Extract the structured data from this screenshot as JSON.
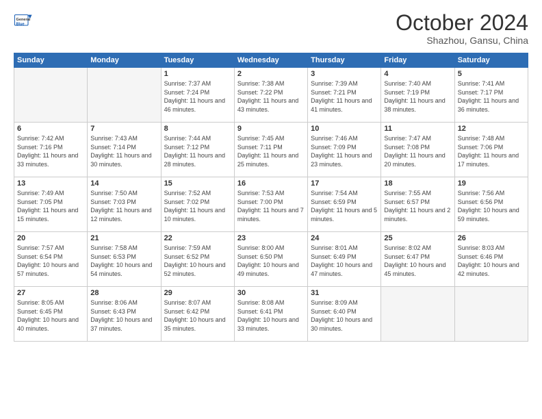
{
  "header": {
    "logo_general": "General",
    "logo_blue": "Blue",
    "month_title": "October 2024",
    "location": "Shazhou, Gansu, China"
  },
  "days_of_week": [
    "Sunday",
    "Monday",
    "Tuesday",
    "Wednesday",
    "Thursday",
    "Friday",
    "Saturday"
  ],
  "weeks": [
    [
      {
        "day": "",
        "info": ""
      },
      {
        "day": "",
        "info": ""
      },
      {
        "day": "1",
        "info": "Sunrise: 7:37 AM\nSunset: 7:24 PM\nDaylight: 11 hours\nand 46 minutes."
      },
      {
        "day": "2",
        "info": "Sunrise: 7:38 AM\nSunset: 7:22 PM\nDaylight: 11 hours\nand 43 minutes."
      },
      {
        "day": "3",
        "info": "Sunrise: 7:39 AM\nSunset: 7:21 PM\nDaylight: 11 hours\nand 41 minutes."
      },
      {
        "day": "4",
        "info": "Sunrise: 7:40 AM\nSunset: 7:19 PM\nDaylight: 11 hours\nand 38 minutes."
      },
      {
        "day": "5",
        "info": "Sunrise: 7:41 AM\nSunset: 7:17 PM\nDaylight: 11 hours\nand 36 minutes."
      }
    ],
    [
      {
        "day": "6",
        "info": "Sunrise: 7:42 AM\nSunset: 7:16 PM\nDaylight: 11 hours\nand 33 minutes."
      },
      {
        "day": "7",
        "info": "Sunrise: 7:43 AM\nSunset: 7:14 PM\nDaylight: 11 hours\nand 30 minutes."
      },
      {
        "day": "8",
        "info": "Sunrise: 7:44 AM\nSunset: 7:12 PM\nDaylight: 11 hours\nand 28 minutes."
      },
      {
        "day": "9",
        "info": "Sunrise: 7:45 AM\nSunset: 7:11 PM\nDaylight: 11 hours\nand 25 minutes."
      },
      {
        "day": "10",
        "info": "Sunrise: 7:46 AM\nSunset: 7:09 PM\nDaylight: 11 hours\nand 23 minutes."
      },
      {
        "day": "11",
        "info": "Sunrise: 7:47 AM\nSunset: 7:08 PM\nDaylight: 11 hours\nand 20 minutes."
      },
      {
        "day": "12",
        "info": "Sunrise: 7:48 AM\nSunset: 7:06 PM\nDaylight: 11 hours\nand 17 minutes."
      }
    ],
    [
      {
        "day": "13",
        "info": "Sunrise: 7:49 AM\nSunset: 7:05 PM\nDaylight: 11 hours\nand 15 minutes."
      },
      {
        "day": "14",
        "info": "Sunrise: 7:50 AM\nSunset: 7:03 PM\nDaylight: 11 hours\nand 12 minutes."
      },
      {
        "day": "15",
        "info": "Sunrise: 7:52 AM\nSunset: 7:02 PM\nDaylight: 11 hours\nand 10 minutes."
      },
      {
        "day": "16",
        "info": "Sunrise: 7:53 AM\nSunset: 7:00 PM\nDaylight: 11 hours\nand 7 minutes."
      },
      {
        "day": "17",
        "info": "Sunrise: 7:54 AM\nSunset: 6:59 PM\nDaylight: 11 hours\nand 5 minutes."
      },
      {
        "day": "18",
        "info": "Sunrise: 7:55 AM\nSunset: 6:57 PM\nDaylight: 11 hours\nand 2 minutes."
      },
      {
        "day": "19",
        "info": "Sunrise: 7:56 AM\nSunset: 6:56 PM\nDaylight: 10 hours\nand 59 minutes."
      }
    ],
    [
      {
        "day": "20",
        "info": "Sunrise: 7:57 AM\nSunset: 6:54 PM\nDaylight: 10 hours\nand 57 minutes."
      },
      {
        "day": "21",
        "info": "Sunrise: 7:58 AM\nSunset: 6:53 PM\nDaylight: 10 hours\nand 54 minutes."
      },
      {
        "day": "22",
        "info": "Sunrise: 7:59 AM\nSunset: 6:52 PM\nDaylight: 10 hours\nand 52 minutes."
      },
      {
        "day": "23",
        "info": "Sunrise: 8:00 AM\nSunset: 6:50 PM\nDaylight: 10 hours\nand 49 minutes."
      },
      {
        "day": "24",
        "info": "Sunrise: 8:01 AM\nSunset: 6:49 PM\nDaylight: 10 hours\nand 47 minutes."
      },
      {
        "day": "25",
        "info": "Sunrise: 8:02 AM\nSunset: 6:47 PM\nDaylight: 10 hours\nand 45 minutes."
      },
      {
        "day": "26",
        "info": "Sunrise: 8:03 AM\nSunset: 6:46 PM\nDaylight: 10 hours\nand 42 minutes."
      }
    ],
    [
      {
        "day": "27",
        "info": "Sunrise: 8:05 AM\nSunset: 6:45 PM\nDaylight: 10 hours\nand 40 minutes."
      },
      {
        "day": "28",
        "info": "Sunrise: 8:06 AM\nSunset: 6:43 PM\nDaylight: 10 hours\nand 37 minutes."
      },
      {
        "day": "29",
        "info": "Sunrise: 8:07 AM\nSunset: 6:42 PM\nDaylight: 10 hours\nand 35 minutes."
      },
      {
        "day": "30",
        "info": "Sunrise: 8:08 AM\nSunset: 6:41 PM\nDaylight: 10 hours\nand 33 minutes."
      },
      {
        "day": "31",
        "info": "Sunrise: 8:09 AM\nSunset: 6:40 PM\nDaylight: 10 hours\nand 30 minutes."
      },
      {
        "day": "",
        "info": ""
      },
      {
        "day": "",
        "info": ""
      }
    ]
  ]
}
